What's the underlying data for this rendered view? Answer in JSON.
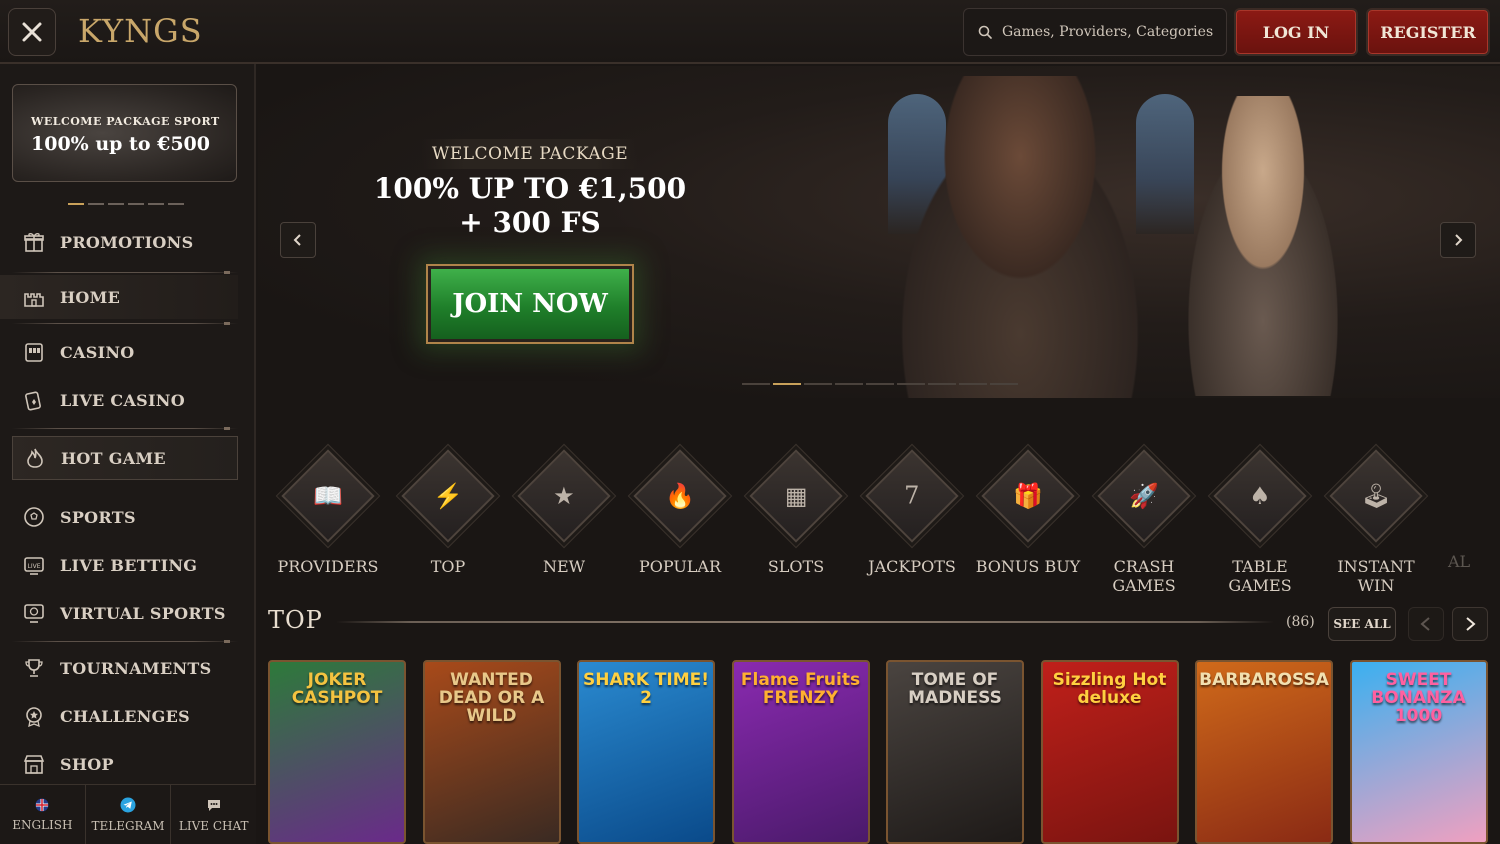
{
  "header": {
    "logo": "KYNGS",
    "search_placeholder": "Games, Providers, Categories",
    "login_label": "LOG IN",
    "register_label": "REGISTER"
  },
  "sidebar": {
    "promo": {
      "subtitle": "WELCOME PACKAGE SPORT",
      "title": "100% up to €500"
    },
    "promo_slides": 6,
    "promo_active_slide": 1,
    "items": [
      {
        "label": "PROMOTIONS",
        "icon": "gift-icon"
      },
      {
        "label": "HOME",
        "icon": "castle-icon"
      },
      {
        "label": "CASINO",
        "icon": "slot-machine-icon"
      },
      {
        "label": "LIVE CASINO",
        "icon": "cards-icon"
      },
      {
        "label": "HOT GAME",
        "icon": "flame-icon"
      },
      {
        "label": "SPORTS",
        "icon": "football-icon"
      },
      {
        "label": "LIVE BETTING",
        "icon": "live-icon"
      },
      {
        "label": "VIRTUAL SPORTS",
        "icon": "virtual-sports-icon"
      },
      {
        "label": "TOURNAMENTS",
        "icon": "trophy-icon"
      },
      {
        "label": "CHALLENGES",
        "icon": "badge-icon"
      },
      {
        "label": "SHOP",
        "icon": "shop-icon"
      }
    ],
    "bottom": [
      {
        "label": "ENGLISH",
        "icon": "uk-flag-icon"
      },
      {
        "label": "TELEGRAM",
        "icon": "telegram-icon"
      },
      {
        "label": "LIVE CHAT",
        "icon": "chat-icon"
      }
    ]
  },
  "hero": {
    "subtitle": "WELCOME PACKAGE",
    "title_line1": "100% UP TO €1,500",
    "title_line2": "+ 300 FS",
    "cta": "JOIN NOW",
    "slides": 9,
    "active_slide": 2
  },
  "categories": [
    {
      "label": "PROVIDERS",
      "icon": "book-icon"
    },
    {
      "label": "TOP",
      "icon": "lightning-icon"
    },
    {
      "label": "NEW",
      "icon": "star-box-icon"
    },
    {
      "label": "POPULAR",
      "icon": "fire-icon"
    },
    {
      "label": "SLOTS",
      "icon": "reels-icon"
    },
    {
      "label": "JACKPOTS",
      "icon": "jackpot-icon"
    },
    {
      "label": "BONUS BUY",
      "icon": "gift-box-icon"
    },
    {
      "label": "CRASH GAMES",
      "icon": "rocket-icon"
    },
    {
      "label": "TABLE GAMES",
      "icon": "card-table-icon"
    },
    {
      "label": "INSTANT WIN",
      "icon": "joystick-icon"
    },
    {
      "label": "AL",
      "icon": "more-icon"
    }
  ],
  "top_section": {
    "title": "TOP",
    "count": "(86)",
    "see_all": "SEE ALL"
  },
  "games": [
    {
      "title": "JOKER CASHPOT",
      "colors": [
        "#2d7a3a",
        "#6a2a8a"
      ],
      "text_color": "#f4c340"
    },
    {
      "title": "WANTED DEAD OR A WILD",
      "colors": [
        "#a84a1a",
        "#3a2a22"
      ],
      "text_color": "#e8c88a"
    },
    {
      "title": "SHARK TIME! 2",
      "colors": [
        "#2a8ad0",
        "#0a4a8a"
      ],
      "text_color": "#ffd040"
    },
    {
      "title": "Flame Fruits FRENZY",
      "colors": [
        "#8a2ab0",
        "#4a1a6a"
      ],
      "text_color": "#ffb030"
    },
    {
      "title": "TOME OF MADNESS",
      "colors": [
        "#4a4440",
        "#1e1a18"
      ],
      "text_color": "#d8cfc4"
    },
    {
      "title": "Sizzling Hot deluxe",
      "colors": [
        "#c0201a",
        "#7a1410"
      ],
      "text_color": "#ffd040"
    },
    {
      "title": "BARBAROSSA",
      "colors": [
        "#d06a1a",
        "#8a2a14"
      ],
      "text_color": "#f2e0b0"
    },
    {
      "title": "SWEET BONANZA 1000",
      "colors": [
        "#3ab0f0",
        "#f0a0c0"
      ],
      "text_color": "#ff60a0"
    }
  ]
}
